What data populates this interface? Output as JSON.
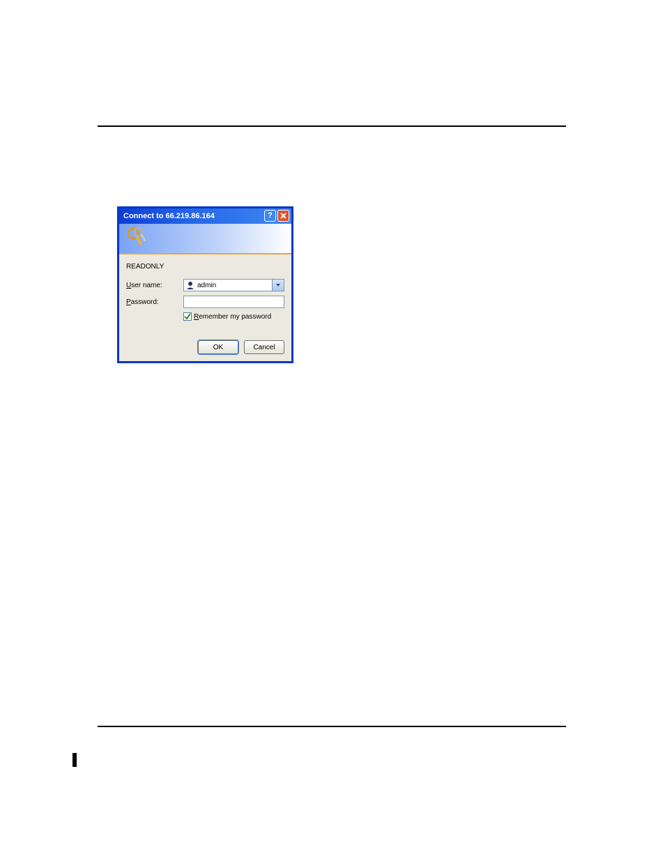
{
  "dialog": {
    "title": "Connect to 66.219.86.164",
    "realm": "READONLY",
    "username_label_pre": "U",
    "username_label_rest": "ser name:",
    "password_label_pre": "P",
    "password_label_rest": "assword:",
    "username_value": "admin",
    "remember_pre": "R",
    "remember_rest": "emember my password",
    "ok_label": "OK",
    "cancel_label": "Cancel"
  }
}
